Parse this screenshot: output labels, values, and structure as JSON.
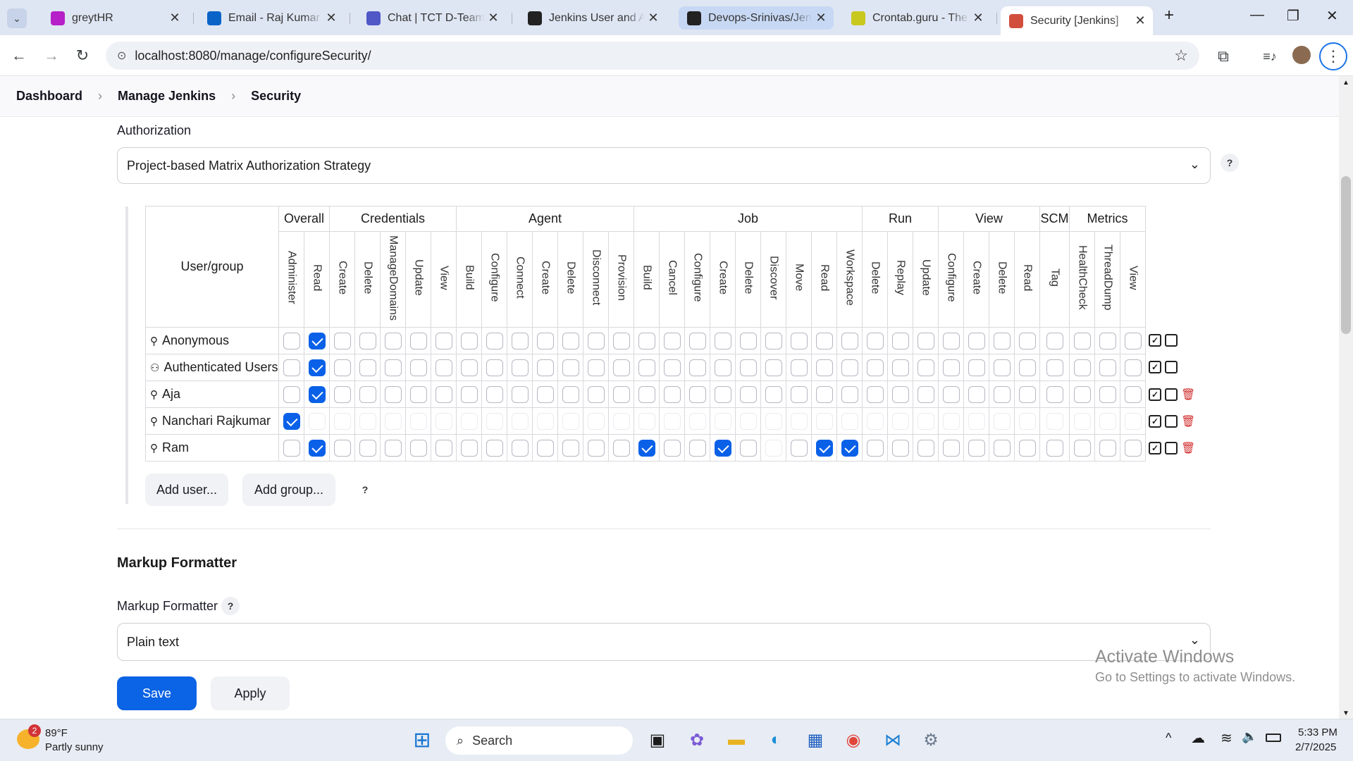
{
  "browser": {
    "tabs": [
      {
        "title": "greytHR",
        "icon": "greythr-icon",
        "color": "#b620c8"
      },
      {
        "title": "Email - Raj Kumar Na",
        "icon": "outlook-icon",
        "color": "#0a64c8"
      },
      {
        "title": "Chat | TCT D-Team | I",
        "icon": "teams-icon",
        "color": "#5058c8"
      },
      {
        "title": "Jenkins User and Adr",
        "icon": "openai-icon",
        "color": "#222222"
      },
      {
        "title": "Devops-Srinivas/Jenl",
        "icon": "github-icon",
        "color": "#222222"
      },
      {
        "title": "Crontab.guru - The c",
        "icon": "crontab-icon",
        "color": "#c8c81e"
      },
      {
        "title": "Security [Jenkins]",
        "icon": "jenkins-icon",
        "color": "#d24e3c"
      }
    ],
    "url": "localhost:8080/manage/configureSecurity/"
  },
  "breadcrumb": [
    "Dashboard",
    "Manage Jenkins",
    "Security"
  ],
  "authorization": {
    "label": "Authorization",
    "strategy": "Project-based Matrix Authorization Strategy",
    "help": "?"
  },
  "matrix": {
    "user_header": "User/group",
    "groups": [
      {
        "name": "Overall",
        "perms": [
          "Administer",
          "Read"
        ]
      },
      {
        "name": "Credentials",
        "perms": [
          "Create",
          "Delete",
          "ManageDomains",
          "Update",
          "View"
        ]
      },
      {
        "name": "Agent",
        "perms": [
          "Build",
          "Configure",
          "Connect",
          "Create",
          "Delete",
          "Disconnect",
          "Provision"
        ]
      },
      {
        "name": "Job",
        "perms": [
          "Build",
          "Cancel",
          "Configure",
          "Create",
          "Delete",
          "Discover",
          "Move",
          "Read",
          "Workspace"
        ]
      },
      {
        "name": "Run",
        "perms": [
          "Delete",
          "Replay",
          "Update"
        ]
      },
      {
        "name": "View",
        "perms": [
          "Configure",
          "Create",
          "Delete",
          "Read"
        ]
      },
      {
        "name": "SCM",
        "perms": [
          "Tag"
        ]
      },
      {
        "name": "Metrics",
        "perms": [
          "HealthCheck",
          "ThreadDump",
          "View"
        ]
      }
    ],
    "rows": [
      {
        "name": "Anonymous",
        "icon": "user-icon",
        "checked": [
          1
        ],
        "disabled": false,
        "deletable": false
      },
      {
        "name": "Authenticated Users",
        "icon": "group-icon",
        "checked": [
          1
        ],
        "disabled": false,
        "deletable": false
      },
      {
        "name": "Aja",
        "icon": "user-icon",
        "checked": [
          1
        ],
        "disabled": false,
        "deletable": true
      },
      {
        "name": "Nanchari Rajkumar",
        "icon": "user-icon",
        "checked": [
          0
        ],
        "disabled": true,
        "deletable": true
      },
      {
        "name": "Ram",
        "icon": "user-icon",
        "checked": [
          1,
          14,
          17,
          21,
          22
        ],
        "disabled": false,
        "deletable": true,
        "hidden": [
          19
        ]
      }
    ],
    "add_user": "Add user...",
    "add_group": "Add group...",
    "help": "?"
  },
  "markup": {
    "heading": "Markup Formatter",
    "label": "Markup Formatter",
    "value": "Plain text",
    "help": "?"
  },
  "actions": {
    "save": "Save",
    "apply": "Apply"
  },
  "watermark": {
    "line1": "Activate Windows",
    "line2": "Go to Settings to activate Windows."
  },
  "taskbar": {
    "weather_temp": "89°F",
    "weather_desc": "Partly sunny",
    "weather_badge": "2",
    "search": "Search",
    "time": "5:33 PM",
    "date": "2/7/2025"
  }
}
